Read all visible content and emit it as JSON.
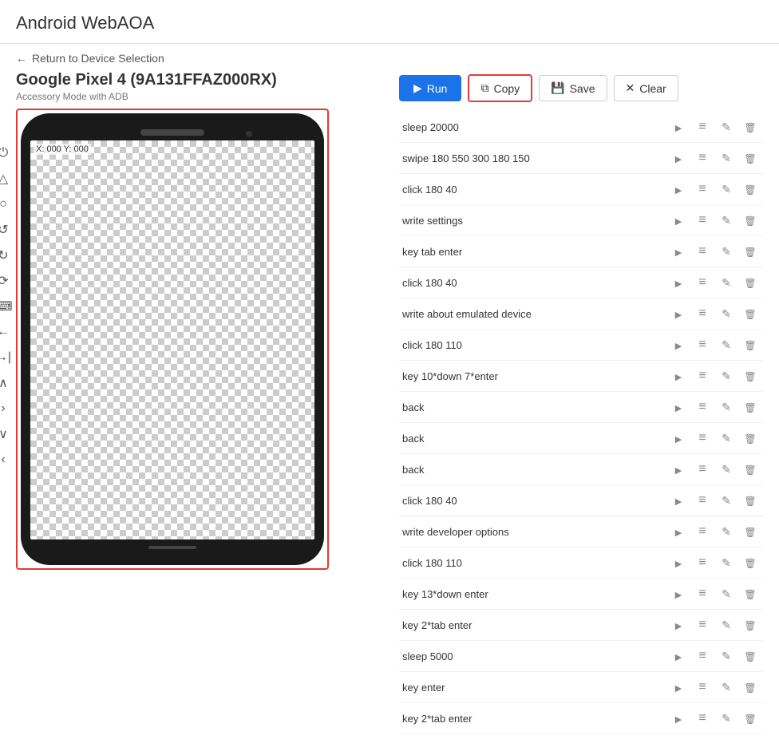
{
  "app": {
    "title": "Android WebAOA"
  },
  "nav": {
    "back_label": "Return to Device Selection"
  },
  "device": {
    "name": "Google Pixel 4 (9A131FFAZ000RX)",
    "subtitle": "Accessory Mode with ADB",
    "coords": "X: 000 Y: 000"
  },
  "toolbar": {
    "run_label": "Run",
    "copy_label": "Copy",
    "save_label": "Save",
    "clear_label": "Clear"
  },
  "commands": [
    {
      "id": 1,
      "text": "sleep 20000"
    },
    {
      "id": 2,
      "text": "swipe 180 550 300 180 150"
    },
    {
      "id": 3,
      "text": "click 180 40"
    },
    {
      "id": 4,
      "text": "write settings"
    },
    {
      "id": 5,
      "text": "key tab enter"
    },
    {
      "id": 6,
      "text": "click 180 40"
    },
    {
      "id": 7,
      "text": "write about emulated device"
    },
    {
      "id": 8,
      "text": "click 180 110"
    },
    {
      "id": 9,
      "text": "key 10*down 7*enter"
    },
    {
      "id": 10,
      "text": "back"
    },
    {
      "id": 11,
      "text": "back"
    },
    {
      "id": 12,
      "text": "back"
    },
    {
      "id": 13,
      "text": "click 180 40"
    },
    {
      "id": 14,
      "text": "write developer options"
    },
    {
      "id": 15,
      "text": "click 180 110"
    },
    {
      "id": 16,
      "text": "key 13*down enter"
    },
    {
      "id": 17,
      "text": "key 2*tab enter"
    },
    {
      "id": 18,
      "text": "sleep 5000"
    },
    {
      "id": 19,
      "text": "key enter"
    },
    {
      "id": 20,
      "text": "key 2*tab enter"
    }
  ],
  "side_controls": [
    {
      "icon": "⏻",
      "name": "power"
    },
    {
      "icon": "△",
      "name": "home"
    },
    {
      "icon": "○",
      "name": "back-circle"
    },
    {
      "icon": "↺",
      "name": "rotate-left"
    },
    {
      "icon": "↻",
      "name": "rotate-right"
    },
    {
      "icon": "⟳",
      "name": "refresh"
    },
    {
      "icon": "⌨",
      "name": "keyboard"
    },
    {
      "icon": "←",
      "name": "arrow-left"
    },
    {
      "icon": "→|",
      "name": "arrow-right-bar"
    },
    {
      "icon": "∧",
      "name": "chevron-up"
    },
    {
      "icon": ">",
      "name": "chevron-right"
    },
    {
      "icon": "∨",
      "name": "chevron-down"
    },
    {
      "icon": "<",
      "name": "chevron-left"
    }
  ]
}
